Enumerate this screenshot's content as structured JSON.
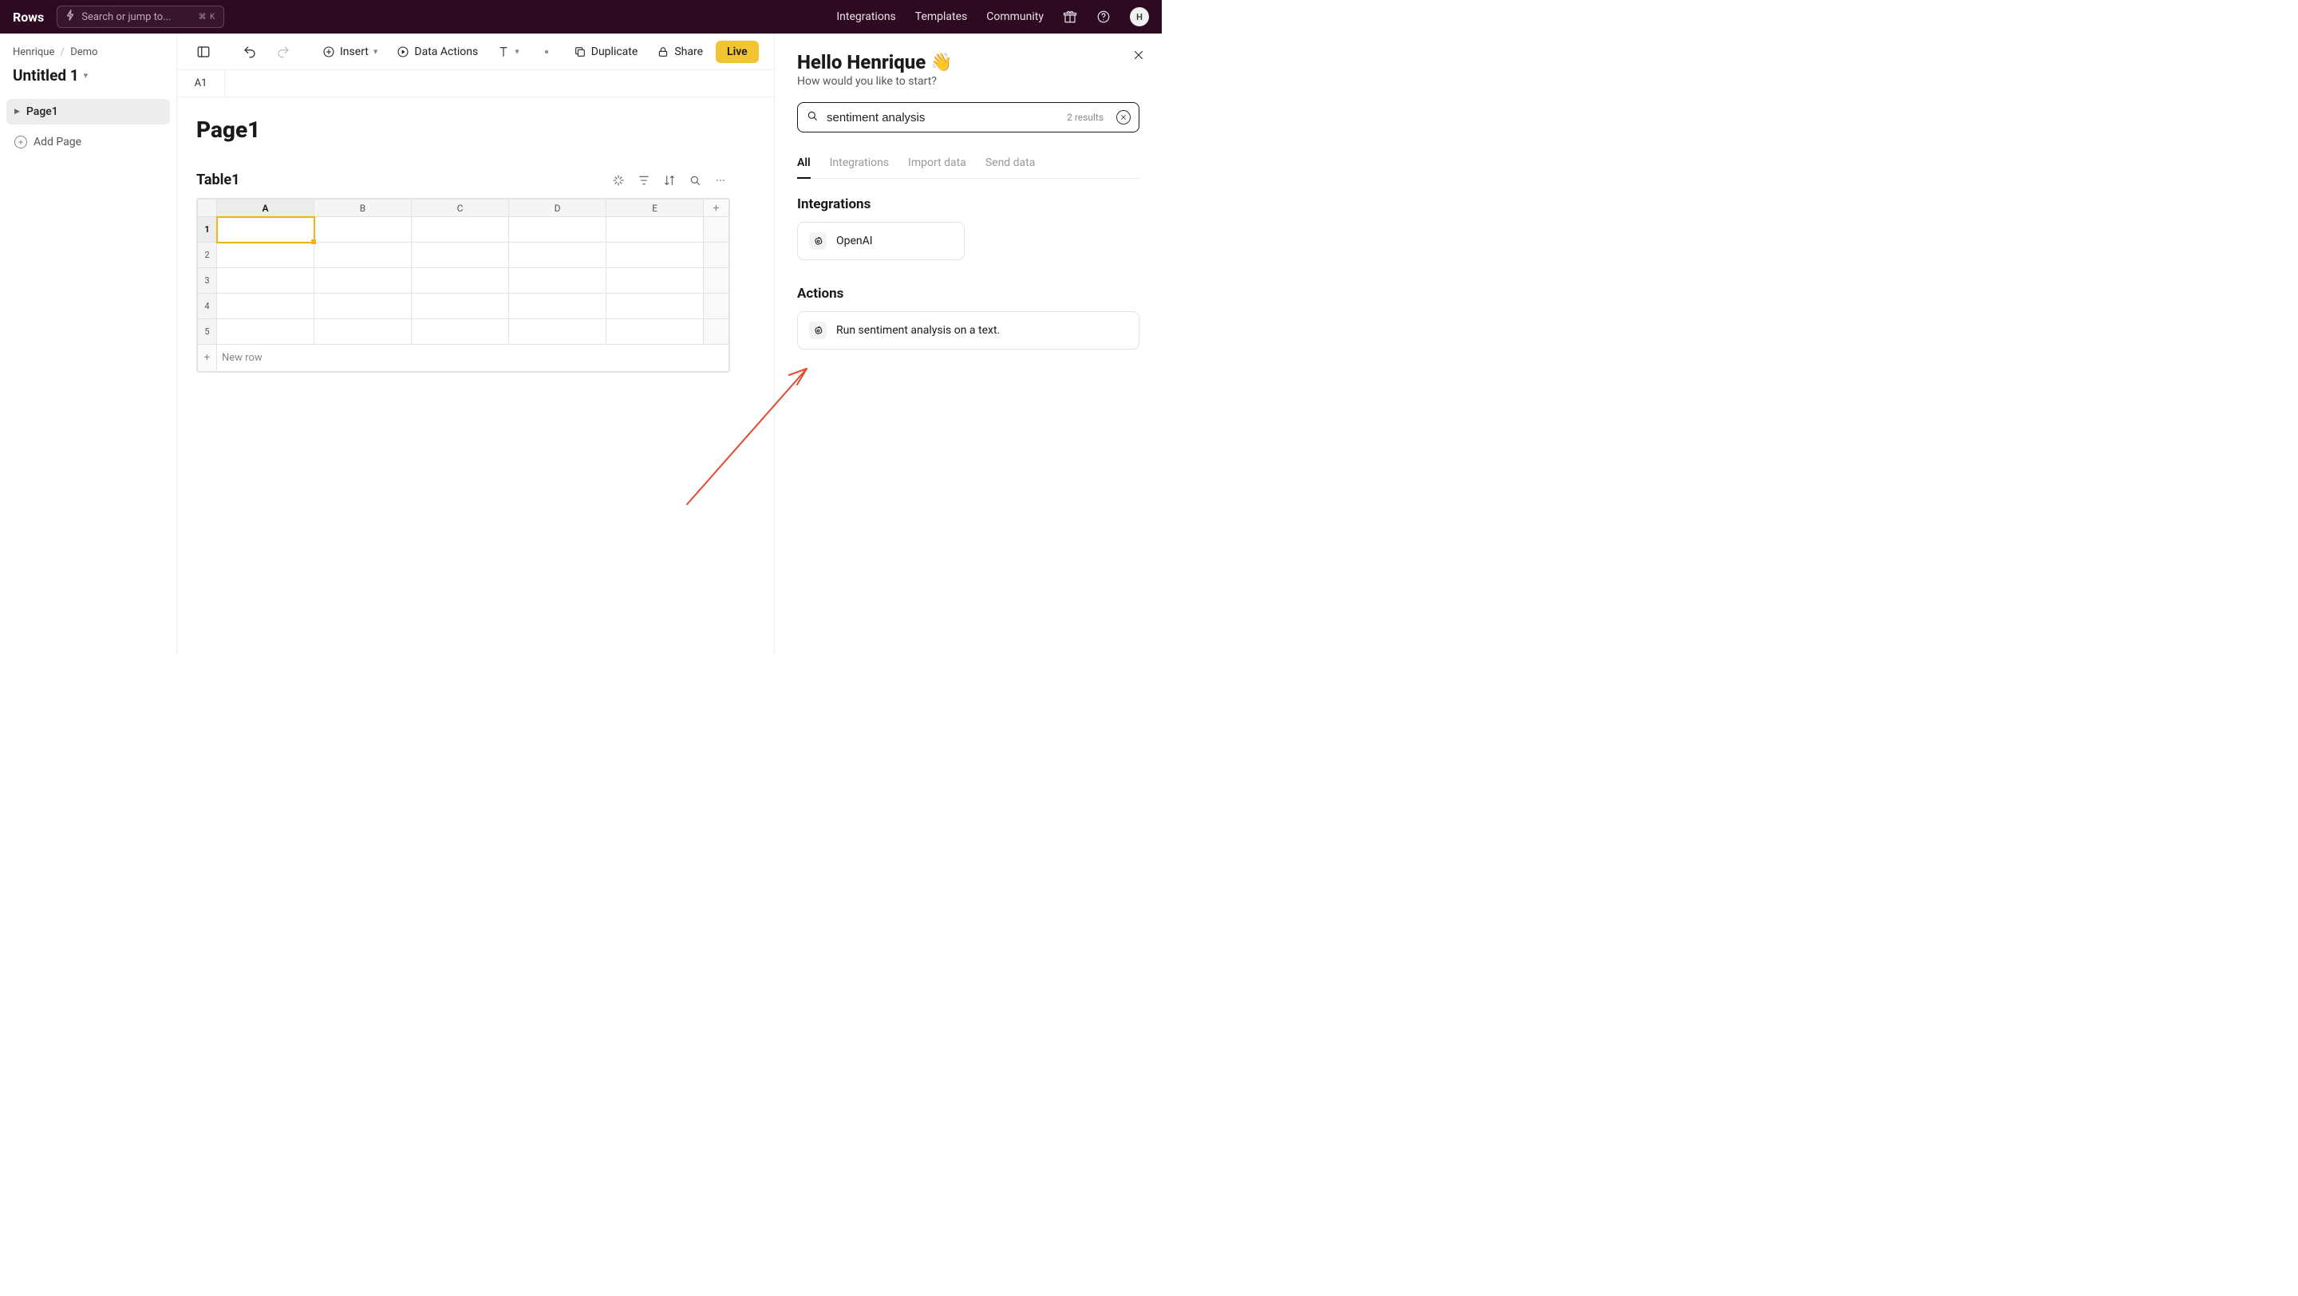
{
  "brand": "Rows",
  "search_jump": {
    "placeholder": "Search or jump to...",
    "shortcut": "⌘ K"
  },
  "topnav": {
    "links": [
      "Integrations",
      "Templates",
      "Community"
    ],
    "avatar_initial": "H"
  },
  "breadcrumb": {
    "user": "Henrique",
    "workspace": "Demo"
  },
  "doc_title": "Untitled 1",
  "sidebar": {
    "pages": [
      "Page1"
    ],
    "add_page_label": "Add Page"
  },
  "toolbar": {
    "insert": "Insert",
    "data_actions": "Data Actions",
    "duplicate": "Duplicate",
    "share": "Share",
    "live": "Live"
  },
  "cell_reference": "A1",
  "page": {
    "title": "Page1",
    "table_title": "Table1",
    "columns": [
      "A",
      "B",
      "C",
      "D",
      "E"
    ],
    "rows": [
      1,
      2,
      3,
      4,
      5
    ],
    "new_row_label": "New row",
    "selected_cell": "A1"
  },
  "right_panel": {
    "greeting": "Hello Henrique",
    "greeting_sub": "How would you like to start?",
    "search_value": "sentiment analysis",
    "results_count": "2 results",
    "tabs": [
      "All",
      "Integrations",
      "Import data",
      "Send data"
    ],
    "active_tab": "All",
    "integrations_heading": "Integrations",
    "integrations": [
      {
        "name": "OpenAI",
        "icon": "openai"
      }
    ],
    "actions_heading": "Actions",
    "actions": [
      {
        "label": "Run sentiment analysis on a text.",
        "icon": "openai"
      }
    ]
  }
}
